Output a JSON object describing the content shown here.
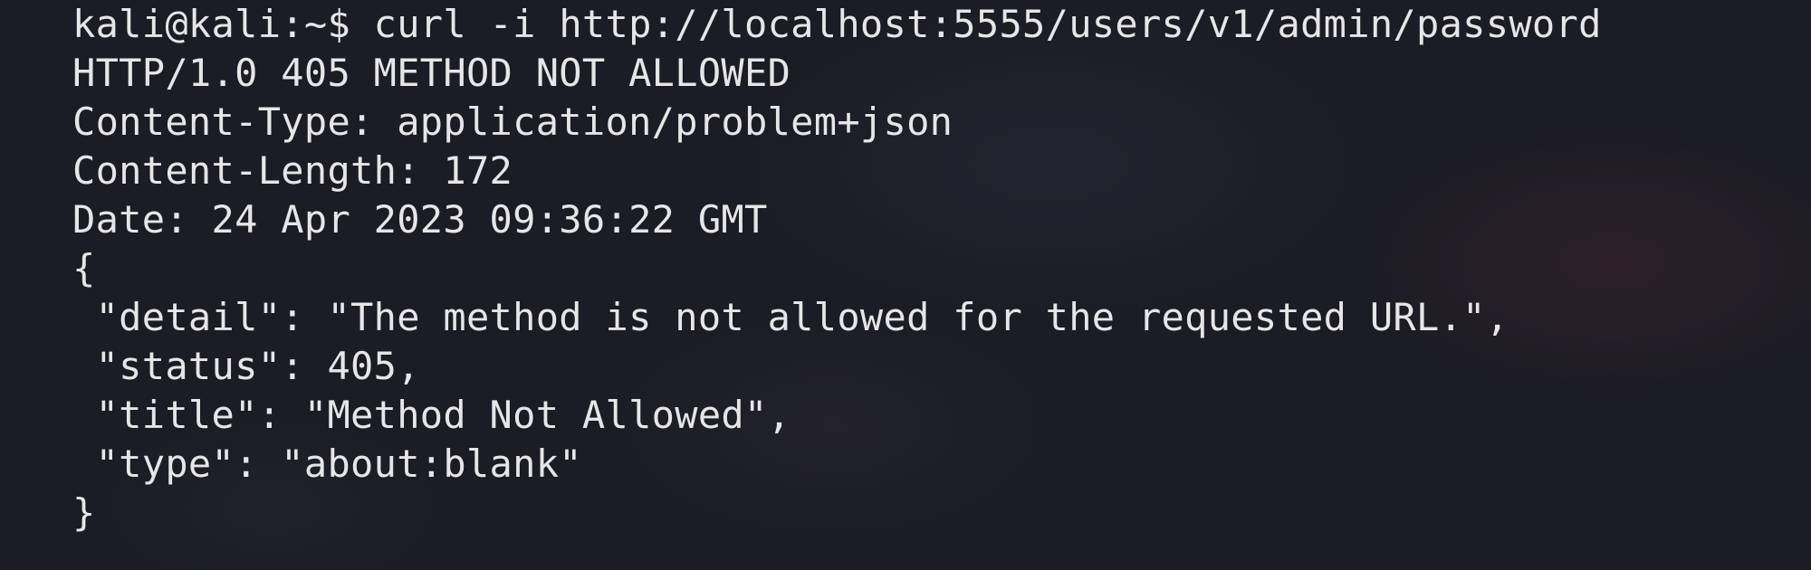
{
  "terminal": {
    "prompt": "kali@kali:~$ ",
    "command": "curl -i http://localhost:5555/users/v1/admin/password",
    "output": [
      "HTTP/1.0 405 METHOD NOT ALLOWED",
      "Content-Type: application/problem+json",
      "Content-Length: 172",
      "Date: 24 Apr 2023 09:36:22 GMT",
      "{",
      " \"detail\": \"The method is not allowed for the requested URL.\",",
      " \"status\": 405,",
      " \"title\": \"Method Not Allowed\",",
      " \"type\": \"about:blank\"",
      "}"
    ]
  }
}
